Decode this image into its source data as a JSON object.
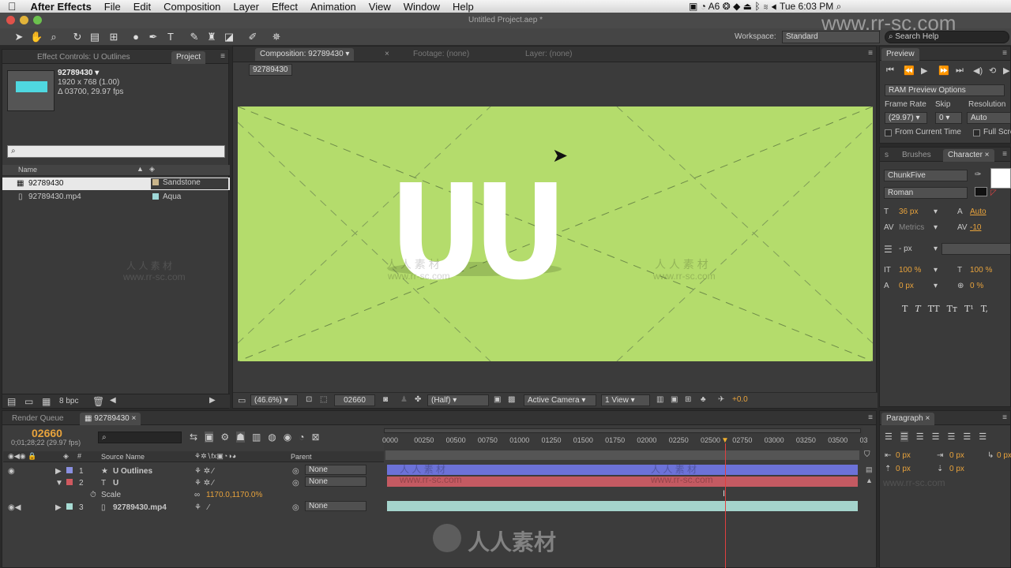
{
  "menubar": {
    "app": "After Effects",
    "items": [
      "File",
      "Edit",
      "Composition",
      "Layer",
      "Effect",
      "Animation",
      "View",
      "Window",
      "Help"
    ],
    "status": {
      "adobe_count": "6",
      "time": "Tue 6:03 PM"
    }
  },
  "window": {
    "title": "Untitled Project.aep *"
  },
  "toolbar": {
    "workspace_label": "Workspace:",
    "workspace_value": "Standard",
    "search_placeholder": "Search Help"
  },
  "project": {
    "tabs": {
      "effect_controls": "Effect Controls: U Outlines",
      "project": "Project"
    },
    "selected_name": "92789430 ▾",
    "info": [
      "1920 x 768 (1.00)",
      "Δ 03700, 29.97 fps"
    ],
    "columns": {
      "name": "Name"
    },
    "items": [
      {
        "name": "92789430",
        "label": "Sandstone",
        "color": "#c8b48a"
      },
      {
        "name": "92789430.mp4",
        "label": "Aqua",
        "color": "#9fd8d8"
      }
    ],
    "bpc": "8 bpc"
  },
  "composition": {
    "tab": "Composition: 92789430",
    "footage_tab": "Footage: (none)",
    "layer_tab": "Layer: (none)",
    "breadcrumb": "92789430",
    "viewer_text": "UU",
    "zoom": "(46.6%)",
    "timecode": "02660",
    "resolution": "(Half)",
    "camera": "Active Camera",
    "views": "1 View",
    "exposure": "+0.0",
    "bg_color": "#b4dc6c"
  },
  "preview": {
    "tab": "Preview",
    "ram_options": "RAM Preview Options",
    "frame_rate_label": "Frame Rate",
    "skip_label": "Skip",
    "resolution_label": "Resolution",
    "frame_rate": "(29.97)",
    "skip": "0",
    "resolution": "Auto",
    "from_current": "From Current Time",
    "full_screen": "Full Scre"
  },
  "character": {
    "tabs": {
      "brushes": "Brushes",
      "character": "Character"
    },
    "font": "ChunkFive",
    "style": "Roman",
    "size": "36 px",
    "leading": "Auto",
    "kerning": "Metrics",
    "tracking": "-10",
    "stroke": "- px",
    "vscale": "100 %",
    "hscale": "100 %",
    "baseline": "0 px",
    "tsume": "0 %",
    "styles": [
      "T",
      "T",
      "TT",
      "Tт",
      "T¹",
      "T,"
    ]
  },
  "paragraph": {
    "tab": "Paragraph",
    "values": [
      "0 px",
      "0 px",
      "0 px",
      "0 px",
      "0 px"
    ]
  },
  "timeline": {
    "tabs": {
      "render": "Render Queue",
      "comp": "92789430"
    },
    "timecode": "02660",
    "timecode_sub": "0;01;28;22 (29.97 fps)",
    "col_source": "Source Name",
    "col_parent": "Parent",
    "ruler": [
      "0000",
      "00250",
      "00500",
      "00750",
      "01000",
      "01250",
      "01500",
      "01750",
      "02000",
      "02250",
      "02500",
      "02750",
      "03000",
      "03250",
      "03500",
      "03"
    ],
    "layers": [
      {
        "num": "1",
        "name": "U Outlines",
        "parent": "None",
        "color": "#8a90e0"
      },
      {
        "num": "2",
        "name": "U",
        "parent": "None",
        "color": "#d0595f"
      },
      {
        "num": "3",
        "name": "92789430.mp4",
        "parent": "None",
        "color": "#a7dcd4"
      }
    ],
    "scale_label": "Scale",
    "scale_value": "1170.0,1170.0%",
    "track_colors": {
      "l1": "#6c72d8",
      "l2": "#c45a62",
      "l3": "#a4d4cc"
    }
  },
  "watermarks": {
    "site": "www.rr-sc.com",
    "cn": "人人素材",
    "cn_spaced": "人 人 素 材"
  }
}
